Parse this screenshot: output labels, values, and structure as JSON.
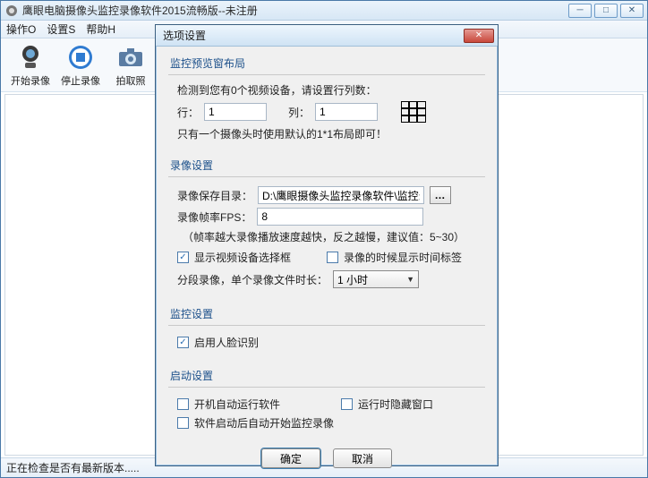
{
  "app": {
    "title": "鹰眼电脑摄像头监控录像软件2015流畅版--未注册",
    "menus": {
      "op": "操作O",
      "set": "设置S",
      "help": "帮助H"
    },
    "tools": {
      "start": "开始录像",
      "stop": "停止录像",
      "shot": "拍取照"
    },
    "status": "正在检查是否有最新版本....."
  },
  "dialog": {
    "title": "选项设置",
    "preview": {
      "legend": "监控预览窗布局",
      "detect": "检测到您有0个视频设备，请设置行列数：",
      "row_label": "行：",
      "row_value": "1",
      "col_label": "列：",
      "col_value": "1",
      "footnote": "只有一个摄像头时使用默认的1*1布局即可！"
    },
    "record": {
      "legend": "录像设置",
      "dir_label": "录像保存目录：",
      "dir_value": "D:\\鹰眼摄像头监控录像软件\\监控录",
      "fps_label": "录像帧率FPS：",
      "fps_value": "8",
      "fps_note": "（帧率越大录像播放速度越快，反之越慢，建议值：5~30）",
      "cb_devsel": "显示视频设备选择框",
      "cb_devsel_checked": true,
      "cb_timelabel": "录像的时候显示时间标签",
      "cb_timelabel_checked": false,
      "segment_label": "分段录像，单个录像文件时长：",
      "segment_value": "1 小时"
    },
    "monitor": {
      "legend": "监控设置",
      "cb_face": "启用人脸识别",
      "cb_face_checked": true
    },
    "startup": {
      "legend": "启动设置",
      "cb_autorun": "开机自动运行软件",
      "cb_autorun_checked": false,
      "cb_hide": "运行时隐藏窗口",
      "cb_hide_checked": false,
      "cb_autorecord": "软件启动后自动开始监控录像",
      "cb_autorecord_checked": false
    },
    "buttons": {
      "ok": "确定",
      "cancel": "取消"
    }
  }
}
